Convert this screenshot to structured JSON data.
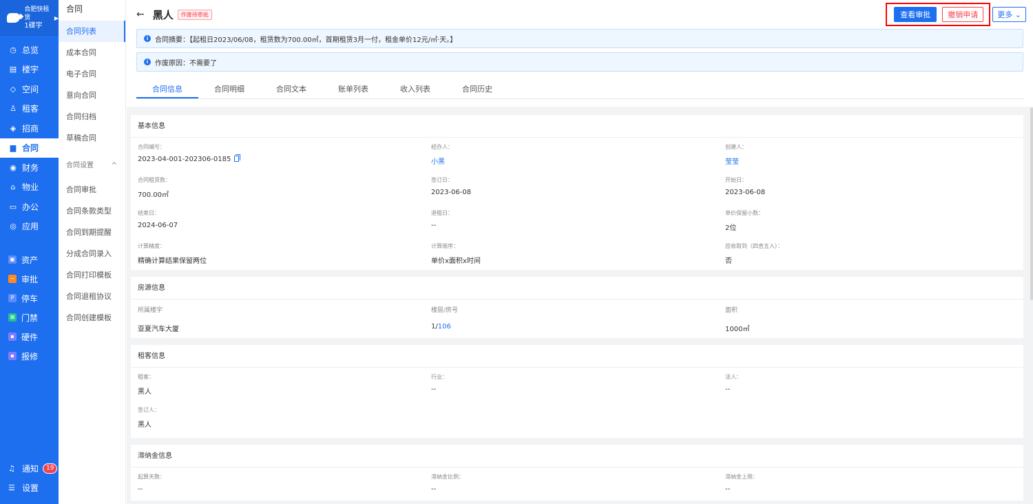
{
  "sidebar": {
    "brand_name": "合肥快租赁",
    "brand_sub": "1碟宇",
    "items": [
      {
        "label": "总览",
        "icon": "dashboard-icon"
      },
      {
        "label": "楼宇",
        "icon": "building-icon"
      },
      {
        "label": "空间",
        "icon": "cube-icon"
      },
      {
        "label": "租客",
        "icon": "users-icon"
      },
      {
        "label": "招商",
        "icon": "tag-icon"
      },
      {
        "label": "合同",
        "icon": "document-icon"
      },
      {
        "label": "财务",
        "icon": "money-icon"
      },
      {
        "label": "物业",
        "icon": "home-icon"
      },
      {
        "label": "办公",
        "icon": "monitor-icon"
      },
      {
        "label": "应用",
        "icon": "app-icon"
      }
    ],
    "apps": [
      {
        "label": "资产",
        "color": "#5b8cff"
      },
      {
        "label": "审批",
        "color": "#ff8a1f"
      },
      {
        "label": "停车",
        "color": "#5b8cff"
      },
      {
        "label": "门禁",
        "color": "#20c38f"
      },
      {
        "label": "硬件",
        "color": "#7e7cff"
      },
      {
        "label": "报修",
        "color": "#7e7cff"
      }
    ],
    "notify_label": "通知",
    "notify_count": "19",
    "settings_label": "设置"
  },
  "submenu": {
    "title": "合同",
    "items": [
      "合同列表",
      "成本合同",
      "电子合同",
      "意向合同",
      "合同归档",
      "草稿合同"
    ],
    "group_label": "合同设置",
    "group_items": [
      "合同审批",
      "合同条款类型",
      "合同到期提醒",
      "分成合同录入",
      "合同打印模板",
      "合同退租协议",
      "合同创建模板"
    ]
  },
  "header": {
    "title": "黑人",
    "status_tag": "作废待审批",
    "btn_view_approval": "查看审批",
    "btn_revoke": "撤销申请",
    "btn_more": "更多",
    "summary": "合同摘要：【起租日2023/06/08，租赁数为700.00㎡，首期租赁3月一付，租金单价12元/㎡·天。】",
    "void_reason": "作废原因：不需要了"
  },
  "tabs": [
    "合同信息",
    "合同明细",
    "合同文本",
    "账单列表",
    "收入列表",
    "合同历史"
  ],
  "basic": {
    "title": "基本信息",
    "fields": [
      {
        "label": "合同编号：",
        "value": "2023-04-001-202306-0185"
      },
      {
        "label": "经办人：",
        "value": "小黑"
      },
      {
        "label": "创建人：",
        "value": "莹莹"
      },
      {
        "label": "合同租赁数：",
        "value": "700.00㎡"
      },
      {
        "label": "签订日：",
        "value": "2023-06-08"
      },
      {
        "label": "开始日：",
        "value": "2023-06-08"
      },
      {
        "label": "结束日：",
        "value": "2024-06-07"
      },
      {
        "label": "退租日：",
        "value": "--"
      },
      {
        "label": "单价保留小数：",
        "value": "2位"
      },
      {
        "label": "计算精度：",
        "value": "精确计算结果保留两位"
      },
      {
        "label": "计算顺序：",
        "value": "单价x面积x时间"
      },
      {
        "label": "应收取到（四舍五入）：",
        "value": "否"
      }
    ]
  },
  "house": {
    "title": "房源信息",
    "fields": [
      {
        "label": "所属楼宇",
        "value": "亚夏汽车大厦"
      },
      {
        "label": "楼层/房号",
        "value_floor": "1/",
        "value_room": "106"
      },
      {
        "label": "面积",
        "value": "1000㎡"
      }
    ]
  },
  "tenant": {
    "title": "租客信息",
    "fields": [
      {
        "label": "租客：",
        "value": "黑人"
      },
      {
        "label": "行业：",
        "value": "--"
      },
      {
        "label": "法人：",
        "value": "--"
      },
      {
        "label": "签订人：",
        "value": "黑人"
      }
    ]
  },
  "late": {
    "title": "滞纳金信息",
    "fields": [
      {
        "label": "起算天数：",
        "value": "--"
      },
      {
        "label": "滞纳金比例：",
        "value": "--"
      },
      {
        "label": "滞纳金上限：",
        "value": "--"
      }
    ]
  }
}
